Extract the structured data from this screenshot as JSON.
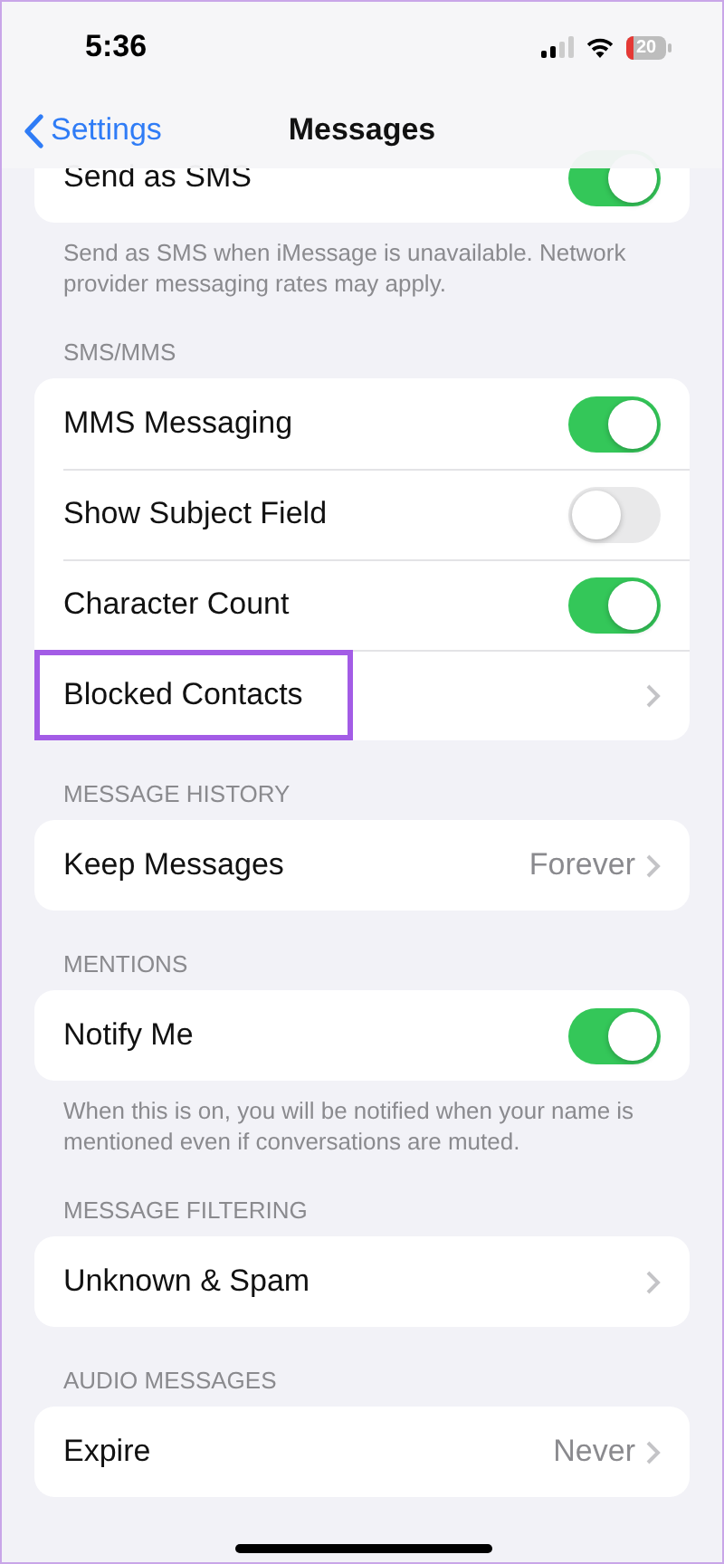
{
  "status_bar": {
    "time": "5:36",
    "battery": "20"
  },
  "nav": {
    "back": "Settings",
    "title": "Messages"
  },
  "sections": [
    {
      "rows": [
        {
          "kind": "toggle",
          "label": "Send as SMS",
          "on": true
        }
      ],
      "footer": "Send as SMS when iMessage is unavailable. Network provider messaging rates may apply."
    },
    {
      "header": "SMS/MMS",
      "rows": [
        {
          "kind": "toggle",
          "label": "MMS Messaging",
          "on": true
        },
        {
          "kind": "toggle",
          "label": "Show Subject Field",
          "on": false
        },
        {
          "kind": "toggle",
          "label": "Character Count",
          "on": true
        },
        {
          "kind": "link",
          "label": "Blocked Contacts",
          "highlighted": true
        }
      ]
    },
    {
      "header": "MESSAGE HISTORY",
      "rows": [
        {
          "kind": "link",
          "label": "Keep Messages",
          "value": "Forever"
        }
      ]
    },
    {
      "header": "MENTIONS",
      "rows": [
        {
          "kind": "toggle",
          "label": "Notify Me",
          "on": true
        }
      ],
      "footer": "When this is on, you will be notified when your name is mentioned even if conversations are muted."
    },
    {
      "header": "MESSAGE FILTERING",
      "rows": [
        {
          "kind": "link",
          "label": "Unknown & Spam"
        }
      ]
    },
    {
      "header": "AUDIO MESSAGES",
      "rows": [
        {
          "kind": "link",
          "label": "Expire",
          "value": "Never"
        }
      ]
    }
  ]
}
